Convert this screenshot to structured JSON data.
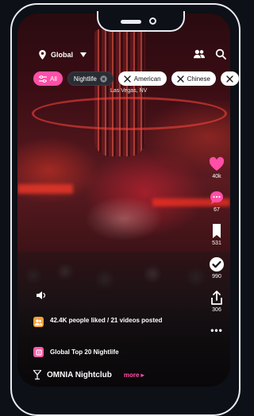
{
  "header": {
    "location_label": "Global",
    "icons": {
      "location": "pin-icon",
      "dropdown": "caret-down-icon",
      "friends": "friends-icon",
      "search": "search-icon"
    }
  },
  "filters": {
    "chips": [
      {
        "label": "All",
        "icon": "sliders-icon",
        "selected": true
      },
      {
        "label": "Nightlife",
        "icon": "close-icon",
        "selected": false
      },
      {
        "label": "American",
        "icon": "utensils-icon",
        "selected": false
      },
      {
        "label": "Chinese",
        "icon": "utensils-icon",
        "selected": false
      }
    ],
    "location_caption": "Las Vegas, NV"
  },
  "actions": {
    "like_count": "40k",
    "comment_count": "67",
    "save_count": "531",
    "visited_count": "990",
    "share_count": "306",
    "more_label": "•••"
  },
  "info": {
    "likes_text": "42.4K people liked / 21 videos posted",
    "list_text": "Global Top 20 Nightlife",
    "venue_name": "OMNIA Nightclub",
    "more_label": "more ▸"
  },
  "colors": {
    "accent": "#ff4fa7",
    "heart": "#ff4fa7",
    "background": "#0d1016"
  }
}
